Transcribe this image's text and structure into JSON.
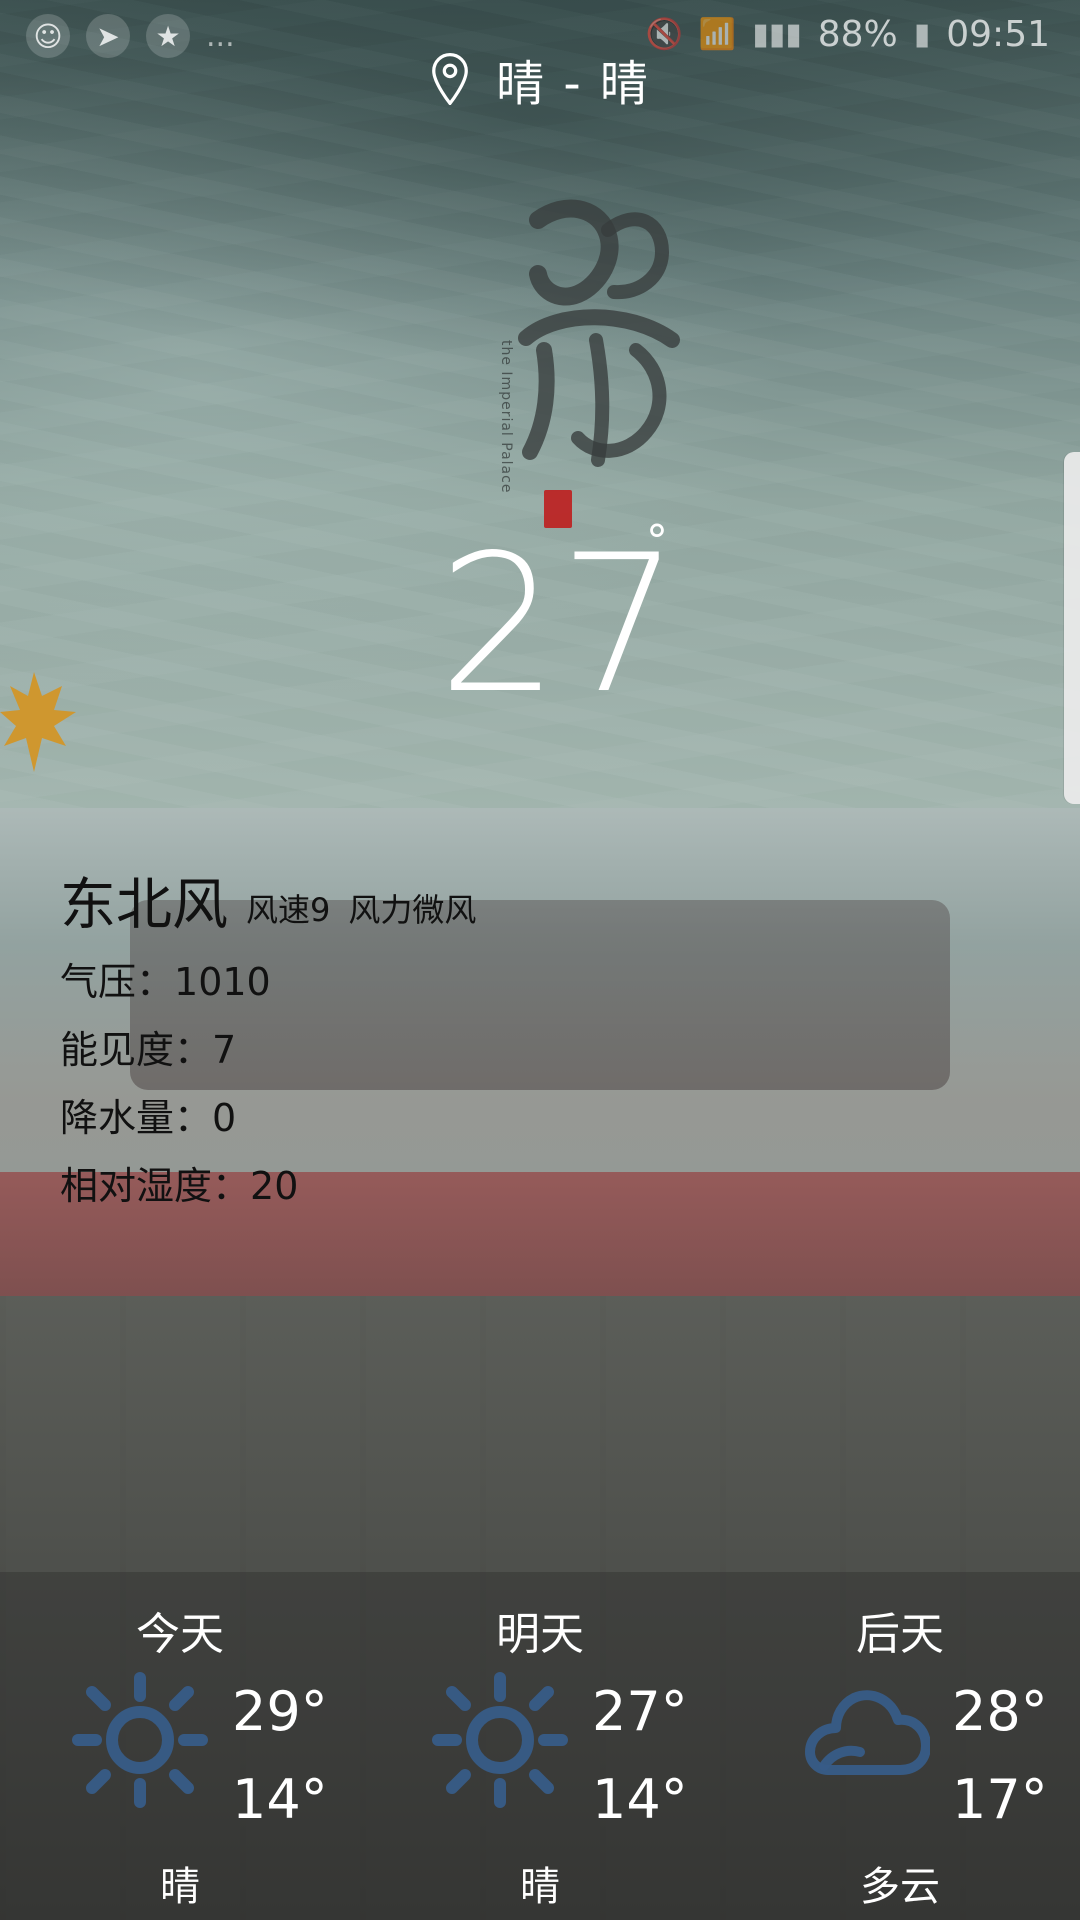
{
  "status_bar": {
    "battery_percent": "88%",
    "time": "09:51",
    "left_more": "..."
  },
  "location": {
    "title": "晴 - 晴",
    "icon": "location-pin-icon"
  },
  "current": {
    "temperature": "27",
    "degree_symbol": "°"
  },
  "details": {
    "wind_direction": "东北风",
    "wind_speed": "风速9",
    "wind_force": "风力微风",
    "pressure_label": "气压：",
    "pressure_value": "1010",
    "visibility_label": "能见度：",
    "visibility_value": "7",
    "precipitation_label": "降水量：",
    "precipitation_value": "0",
    "humidity_label": "相对湿度：",
    "humidity_value": "20"
  },
  "forecast": [
    {
      "label": "今天",
      "hi": "29°",
      "lo": "14°",
      "condition": "晴",
      "icon": "sun-icon"
    },
    {
      "label": "明天",
      "hi": "27°",
      "lo": "14°",
      "condition": "晴",
      "icon": "sun-icon"
    },
    {
      "label": "后天",
      "hi": "28°",
      "lo": "17°",
      "condition": "多云",
      "icon": "cloud-icon"
    }
  ],
  "branding": {
    "logo_text_cn": "故宫",
    "logo_text_en": "the Imperial Palace"
  }
}
